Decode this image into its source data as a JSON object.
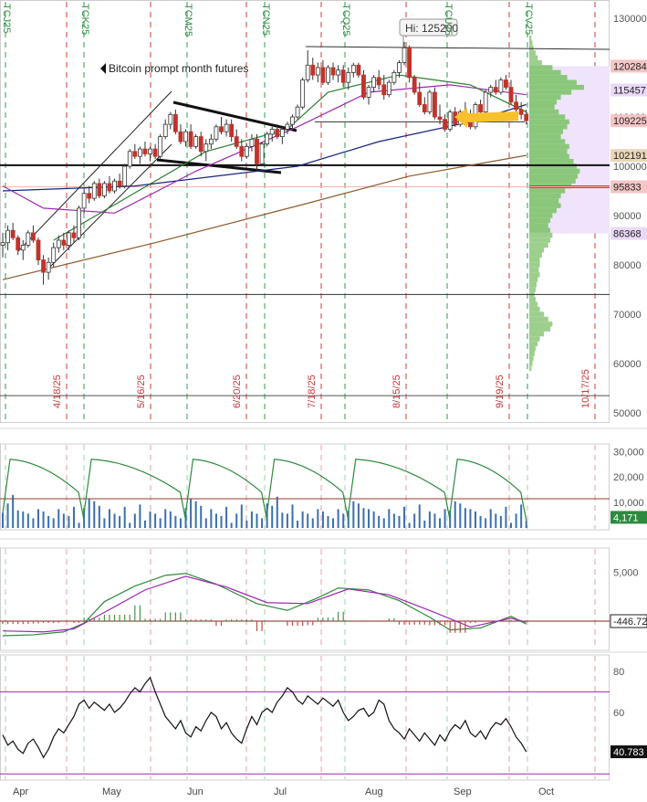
{
  "chart_data": {
    "type": "candlestick",
    "annotation": "Bitcoin prompt month futures",
    "hi_label": "Hi: 125200",
    "contract_labels": [
      "TCJ25",
      "TCK25",
      "TCM25",
      "TCN25",
      "TCQ25",
      "TCU25",
      "TCV25"
    ],
    "expiry_labels": [
      "4/18/25",
      "5/16/25",
      "6/20/25",
      "7/18/25",
      "8/15/25",
      "9/19/25",
      "10/17/25"
    ],
    "x_labels": [
      "Apr",
      "May",
      "Jun",
      "Jul",
      "Aug",
      "Sep",
      "Oct"
    ],
    "price_axis": {
      "ticks": [
        130000,
        120000,
        110000,
        100000,
        90000,
        80000,
        70000,
        60000,
        50000
      ],
      "tick_labels": [
        "130000",
        "120000",
        "110000",
        "100000",
        "90000",
        "80000",
        "70000",
        "60000",
        "50000"
      ],
      "ylim": [
        49000,
        134000
      ]
    },
    "price_markers": [
      {
        "label": "120284",
        "value": 120284,
        "color": "#f4c6c6"
      },
      {
        "label": "115457",
        "value": 115457,
        "color": "#e9d9f7"
      },
      {
        "label": "109225",
        "value": 109225,
        "color": "#f4c6c6"
      },
      {
        "label": "102191",
        "value": 102191,
        "color": "#ead7b8"
      },
      {
        "label": "95833",
        "value": 95833,
        "color": "#f4c6c6"
      },
      {
        "label": "86368",
        "value": 86368,
        "color": "#e9d9f7"
      }
    ],
    "horizontal_levels": [
      125200,
      109000,
      100200,
      74000,
      53500
    ],
    "ohlc": [
      [
        84000,
        86500,
        81500,
        84500
      ],
      [
        84500,
        88000,
        83000,
        87000
      ],
      [
        87000,
        88500,
        85000,
        85500
      ],
      [
        85500,
        86000,
        82000,
        83000
      ],
      [
        83000,
        85000,
        81000,
        84000
      ],
      [
        84000,
        87000,
        83500,
        86500
      ],
      [
        86500,
        88000,
        84500,
        85000
      ],
      [
        85000,
        85500,
        80000,
        81000
      ],
      [
        81000,
        82000,
        76000,
        78500
      ],
      [
        78500,
        81500,
        77000,
        80500
      ],
      [
        80500,
        84500,
        79500,
        83500
      ],
      [
        83500,
        86000,
        82500,
        85000
      ],
      [
        85000,
        86500,
        83000,
        84000
      ],
      [
        84000,
        87000,
        83000,
        86500
      ],
      [
        86500,
        88000,
        84500,
        85500
      ],
      [
        85500,
        92000,
        85000,
        91500
      ],
      [
        91500,
        95500,
        90500,
        94500
      ],
      [
        94500,
        96000,
        92500,
        93500
      ],
      [
        93500,
        97000,
        93000,
        96500
      ],
      [
        96500,
        97500,
        93500,
        94000
      ],
      [
        94000,
        97000,
        93500,
        96500
      ],
      [
        96500,
        98000,
        94500,
        95000
      ],
      [
        95000,
        97500,
        94500,
        97000
      ],
      [
        97000,
        98500,
        95500,
        96000
      ],
      [
        96000,
        100500,
        95500,
        100000
      ],
      [
        100000,
        103500,
        99500,
        103000
      ],
      [
        103000,
        104500,
        101500,
        102000
      ],
      [
        102000,
        104000,
        100500,
        103500
      ],
      [
        103500,
        105000,
        102000,
        102500
      ],
      [
        102500,
        104000,
        101000,
        103500
      ],
      [
        103500,
        104500,
        101500,
        102000
      ],
      [
        102000,
        106500,
        101500,
        106000
      ],
      [
        106000,
        109500,
        105500,
        108500
      ],
      [
        108500,
        111000,
        107500,
        110500
      ],
      [
        110500,
        111500,
        106500,
        107000
      ],
      [
        107000,
        108500,
        104500,
        105000
      ],
      [
        105000,
        107500,
        104000,
        107000
      ],
      [
        107000,
        108500,
        103500,
        104000
      ],
      [
        104000,
        106500,
        103500,
        106000
      ],
      [
        106000,
        107000,
        102000,
        103000
      ],
      [
        103000,
        105500,
        101000,
        104500
      ],
      [
        104500,
        106500,
        103500,
        105500
      ],
      [
        105500,
        108500,
        105000,
        108000
      ],
      [
        108000,
        110000,
        106500,
        107000
      ],
      [
        107000,
        109500,
        106000,
        108500
      ],
      [
        108500,
        109500,
        105000,
        106000
      ],
      [
        106000,
        107500,
        103500,
        104000
      ],
      [
        104000,
        105500,
        101000,
        102000
      ],
      [
        102000,
        104500,
        101500,
        104000
      ],
      [
        104000,
        106500,
        103000,
        105500
      ],
      [
        105500,
        106500,
        99000,
        100500
      ],
      [
        100500,
        105000,
        100000,
        104500
      ],
      [
        104500,
        107000,
        104000,
        106500
      ],
      [
        106500,
        108000,
        105000,
        107500
      ],
      [
        107500,
        108500,
        105500,
        106000
      ],
      [
        106000,
        108000,
        104500,
        107500
      ],
      [
        107500,
        109000,
        106500,
        108500
      ],
      [
        108500,
        110500,
        107500,
        110000
      ],
      [
        110000,
        112500,
        109500,
        112000
      ],
      [
        112000,
        118000,
        111500,
        117500
      ],
      [
        117500,
        123500,
        117000,
        120500
      ],
      [
        120500,
        122000,
        117500,
        118500
      ],
      [
        118500,
        121000,
        117000,
        120000
      ],
      [
        120000,
        121500,
        116500,
        117000
      ],
      [
        117000,
        120500,
        116500,
        120000
      ],
      [
        120000,
        121000,
        117500,
        118500
      ],
      [
        118500,
        120500,
        117000,
        119500
      ],
      [
        119500,
        120500,
        116000,
        117000
      ],
      [
        117000,
        120000,
        115500,
        119000
      ],
      [
        119000,
        121000,
        118000,
        120500
      ],
      [
        120500,
        121000,
        118000,
        118500
      ],
      [
        118500,
        119500,
        113500,
        114000
      ],
      [
        114000,
        116500,
        112500,
        116000
      ],
      [
        116000,
        118500,
        115000,
        118000
      ],
      [
        118000,
        119500,
        115500,
        116500
      ],
      [
        116500,
        118500,
        113500,
        114500
      ],
      [
        114500,
        117500,
        114000,
        117000
      ],
      [
        117000,
        119500,
        116500,
        119000
      ],
      [
        119000,
        121500,
        118000,
        121000
      ],
      [
        121000,
        125200,
        120500,
        124000
      ],
      [
        124000,
        124500,
        117000,
        118000
      ],
      [
        118000,
        118500,
        114500,
        115000
      ],
      [
        115000,
        117000,
        112000,
        112500
      ],
      [
        112500,
        114000,
        110500,
        111000
      ],
      [
        111000,
        115500,
        110500,
        115000
      ],
      [
        115000,
        116000,
        109500,
        110000
      ],
      [
        110000,
        112500,
        108500,
        109500
      ],
      [
        109500,
        110500,
        107000,
        107500
      ],
      [
        107500,
        111500,
        107000,
        111000
      ],
      [
        111000,
        112000,
        108000,
        108500
      ],
      [
        108500,
        111500,
        108000,
        111000
      ],
      [
        111000,
        113000,
        109500,
        110500
      ],
      [
        110500,
        111500,
        107500,
        108000
      ],
      [
        108000,
        113000,
        107500,
        112500
      ],
      [
        112500,
        113500,
        110500,
        111000
      ],
      [
        111000,
        115500,
        110500,
        115000
      ],
      [
        115000,
        116500,
        114000,
        116000
      ],
      [
        116000,
        117500,
        114500,
        115000
      ],
      [
        115000,
        118000,
        114500,
        117500
      ],
      [
        117500,
        118500,
        115500,
        116000
      ],
      [
        116000,
        117500,
        112500,
        113000
      ],
      [
        113000,
        114500,
        110500,
        111500
      ],
      [
        111500,
        113000,
        109500,
        110500
      ],
      [
        110500,
        111500,
        108500,
        109225
      ]
    ],
    "moving_averages": [
      {
        "color": "#1a237e",
        "values": [
          [
            0,
            95000
          ],
          [
            26,
            96000
          ],
          [
            58,
            100000
          ],
          [
            74,
            105000
          ],
          [
            92,
            109000
          ],
          [
            103,
            112500
          ]
        ]
      },
      {
        "color": "#9c27b0",
        "values": [
          [
            0,
            96000
          ],
          [
            8,
            91500
          ],
          [
            22,
            90500
          ],
          [
            38,
            99000
          ],
          [
            58,
            108000
          ],
          [
            72,
            115000
          ],
          [
            88,
            116500
          ],
          [
            103,
            114500
          ]
        ]
      },
      {
        "color": "#2e7d32",
        "values": [
          [
            10,
            85000
          ],
          [
            25,
            94000
          ],
          [
            40,
            103000
          ],
          [
            56,
            107500
          ],
          [
            64,
            115000
          ],
          [
            78,
            118500
          ],
          [
            92,
            116500
          ],
          [
            103,
            111000
          ]
        ]
      },
      {
        "color": "#8d5a2b",
        "values": [
          [
            0,
            77000
          ],
          [
            30,
            84500
          ],
          [
            60,
            92500
          ],
          [
            80,
            98000
          ],
          [
            103,
            102200
          ]
        ]
      }
    ],
    "volume_profile": [
      [
        126000,
        2
      ],
      [
        125000,
        3
      ],
      [
        124000,
        4
      ],
      [
        123000,
        6
      ],
      [
        122000,
        8
      ],
      [
        121000,
        12
      ],
      [
        120000,
        22
      ],
      [
        119000,
        30
      ],
      [
        118000,
        36
      ],
      [
        117000,
        45
      ],
      [
        116000,
        52
      ],
      [
        115000,
        40
      ],
      [
        114000,
        30
      ],
      [
        113000,
        26
      ],
      [
        112000,
        24
      ],
      [
        111000,
        28
      ],
      [
        110000,
        34
      ],
      [
        109000,
        38
      ],
      [
        108000,
        36
      ],
      [
        107000,
        32
      ],
      [
        106000,
        30
      ],
      [
        105000,
        34
      ],
      [
        104000,
        38
      ],
      [
        103000,
        36
      ],
      [
        102000,
        38
      ],
      [
        101000,
        42
      ],
      [
        100000,
        45
      ],
      [
        99000,
        48
      ],
      [
        98000,
        46
      ],
      [
        97000,
        44
      ],
      [
        96000,
        40
      ],
      [
        95000,
        34
      ],
      [
        94000,
        30
      ],
      [
        93000,
        28
      ],
      [
        92000,
        30
      ],
      [
        91000,
        26
      ],
      [
        90000,
        22
      ],
      [
        89000,
        20
      ],
      [
        88000,
        18
      ],
      [
        87000,
        20
      ],
      [
        86000,
        22
      ],
      [
        85000,
        20
      ],
      [
        84000,
        18
      ],
      [
        83000,
        14
      ],
      [
        82000,
        12
      ],
      [
        81000,
        10
      ],
      [
        80000,
        10
      ],
      [
        79000,
        9
      ],
      [
        78000,
        10
      ],
      [
        77000,
        8
      ],
      [
        76000,
        7
      ],
      [
        75000,
        6
      ],
      [
        74000,
        5
      ],
      [
        73000,
        6
      ],
      [
        72000,
        8
      ],
      [
        71000,
        10
      ],
      [
        70000,
        14
      ],
      [
        69000,
        18
      ],
      [
        68000,
        22
      ],
      [
        67000,
        20
      ],
      [
        66000,
        14
      ],
      [
        65000,
        10
      ],
      [
        64000,
        8
      ],
      [
        63000,
        6
      ],
      [
        62000,
        5
      ],
      [
        61000,
        4
      ],
      [
        60000,
        3
      ],
      [
        59000,
        2
      ]
    ],
    "volume_panel": {
      "tick_labels": [
        "30,000",
        "20,000",
        "10,000"
      ],
      "ticks": [
        30000,
        20000,
        10000
      ],
      "ylim": [
        0,
        33000
      ],
      "last_label": "4,171",
      "last_value": 4171
    },
    "macd_panel": {
      "tick_labels": [
        "5,000"
      ],
      "ticks": [
        5000
      ],
      "ylim": [
        -3000,
        7500
      ],
      "last_label": "-446.72",
      "last_value": -446.72
    },
    "rsi_panel": {
      "tick_labels": [
        "80",
        "60",
        "40"
      ],
      "ticks": [
        80,
        60,
        40
      ],
      "ylim": [
        27,
        88
      ],
      "overbought": 70,
      "oversold": 30,
      "last_label": "40.783",
      "last_value": 40.783
    }
  }
}
